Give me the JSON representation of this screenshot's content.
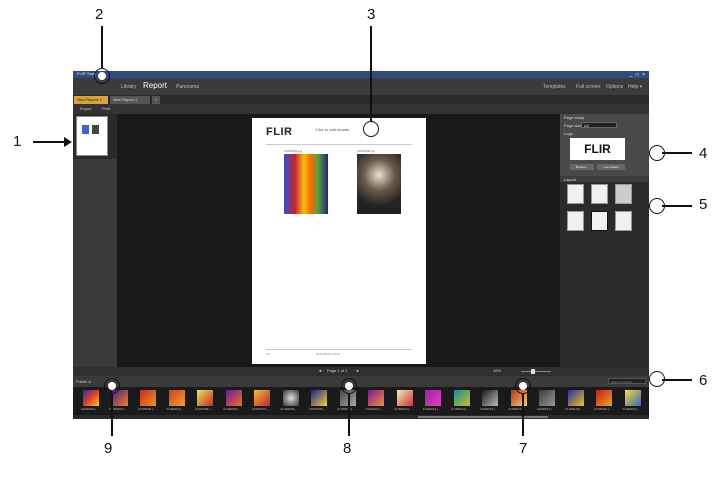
{
  "callouts": {
    "n1": "1",
    "n2": "2",
    "n3": "3",
    "n4": "4",
    "n5": "5",
    "n6": "6",
    "n7": "7",
    "n8": "8",
    "n9": "9"
  },
  "titlebar": {
    "title": "FLIR Tools",
    "window_controls": "_ □ ×"
  },
  "menu": {
    "items": [
      "Library",
      "Report",
      "Panorama"
    ],
    "right_items": [
      "Templates",
      "Full screen",
      "Options",
      "Help ▾"
    ],
    "selected": "Report"
  },
  "tabs": [
    {
      "label": "New Report 1",
      "active": true
    },
    {
      "label": "New Report 2",
      "active": false
    },
    {
      "label": "+",
      "active": false
    }
  ],
  "toolbar": {
    "export": "Export",
    "print": "Print"
  },
  "page": {
    "logo": "FLIR",
    "header_placeholder": "Click to add header",
    "img_label": "FLIR0005.jpg",
    "img2_label": "FLIR0006.jpg",
    "footer_left": "1/1",
    "footer_center": "2013-08-14 09:12"
  },
  "right_panel": {
    "page_setup": "Page setup",
    "page_size": "Page size",
    "page_size_value": "A4",
    "logo_label": "Logo",
    "browse": "Browse...",
    "use_default": "Use default",
    "layout": "Layout"
  },
  "pager": {
    "page_text": "Page 1 of 1",
    "zoom": "49%"
  },
  "filmstrip": {
    "folder": "Folder A",
    "search_placeholder": "Search in library",
    "items": [
      {
        "label": "FLIR0001.j..."
      },
      {
        "label": "FLIR0002.j..."
      },
      {
        "label": "FLIR0003.j..."
      },
      {
        "label": "FLIR0004.j..."
      },
      {
        "label": "FLIR0005.j..."
      },
      {
        "label": "FLIR0006.j..."
      },
      {
        "label": "FLIR0007.j..."
      },
      {
        "label": "FLIR0008.j..."
      },
      {
        "label": "FLIR0009.j..."
      },
      {
        "label": "FLIR0010.j..."
      },
      {
        "label": "FLIR0011.j..."
      },
      {
        "label": "FLIR0012.j..."
      },
      {
        "label": "FLIR0013.j..."
      },
      {
        "label": "FLIR0014.j..."
      },
      {
        "label": "FLIR0015.j..."
      },
      {
        "label": "FLIR0016.j..."
      },
      {
        "label": "FLIR0017.j..."
      },
      {
        "label": "FLIR0018.j..."
      },
      {
        "label": "FLIR0019.j..."
      },
      {
        "label": "FLIR0020.j..."
      }
    ]
  },
  "colors": {
    "accent": "#d9a33a",
    "frame": "#1e1e1e",
    "titlebar": "#2e4b86"
  }
}
